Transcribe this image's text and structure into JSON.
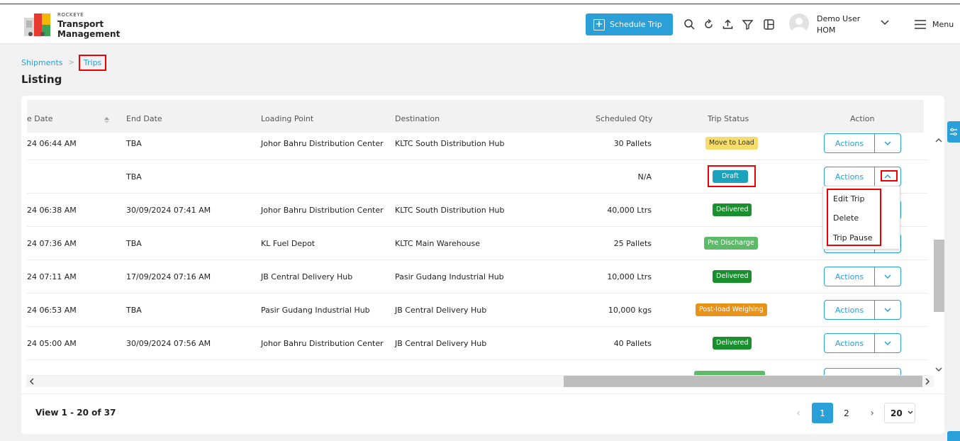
{
  "header": {
    "brand_small": "ROCKEYE",
    "brand_line1": "Transport",
    "brand_line2": "Management",
    "schedule_button": "Schedule Trip",
    "user_name": "Demo User",
    "user_org": "HOM",
    "menu_label": "Menu"
  },
  "breadcrumb": {
    "parent": "Shipments",
    "separator": ">",
    "current": "Trips"
  },
  "page_title": "Listing",
  "table": {
    "headers": {
      "start_date": "e Date",
      "end_date": "End Date",
      "loading_point": "Loading Point",
      "destination": "Destination",
      "scheduled_qty": "Scheduled Qty",
      "trip_status": "Trip Status",
      "action": "Action"
    },
    "action_label": "Actions",
    "rows": [
      {
        "start": "24 06:44 AM",
        "end": "TBA",
        "loading": "Johor Bahru Distribution Center",
        "destination": "KLTC South Distribution Hub",
        "qty": "30 Pallets",
        "status": "Move to Load"
      },
      {
        "start": "",
        "end": "TBA",
        "loading": "",
        "destination": "",
        "qty": "N/A",
        "status": "Draft"
      },
      {
        "start": "24 06:38 AM",
        "end": "30/09/2024 07:41 AM",
        "loading": "Johor Bahru Distribution Center",
        "destination": "KLTC South Distribution Hub",
        "qty": "40,000 Ltrs",
        "status": "Delivered"
      },
      {
        "start": "24 07:36 AM",
        "end": "TBA",
        "loading": "KL Fuel Depot",
        "destination": "KLTC Main Warehouse",
        "qty": "25 Pallets",
        "status": "Pre Discharge"
      },
      {
        "start": "24 07:11 AM",
        "end": "17/09/2024 07:16 AM",
        "loading": "JB Central Delivery Hub",
        "destination": "Pasir Gudang Industrial Hub",
        "qty": "10,000 Ltrs",
        "status": "Delivered"
      },
      {
        "start": "24 06:53 AM",
        "end": "TBA",
        "loading": "Pasir Gudang Industrial Hub",
        "destination": "JB Central Delivery Hub",
        "qty": "10,000 kgs",
        "status": "Post-load Weighing"
      },
      {
        "start": "24 05:00 AM",
        "end": "30/09/2024 07:56 AM",
        "loading": "Johor Bahru Distribution Center",
        "destination": "JB Central Delivery Hub",
        "qty": "40 Pallets",
        "status": "Delivered"
      }
    ]
  },
  "dropdown": {
    "items": [
      "Edit Trip",
      "Delete",
      "Trip Pause"
    ]
  },
  "footer": {
    "view_count": "View 1 - 20 of 37",
    "pages": [
      "1",
      "2"
    ],
    "page_size": "20"
  },
  "colors": {
    "accent": "#2a9fd8",
    "highlight": "#e00000"
  }
}
